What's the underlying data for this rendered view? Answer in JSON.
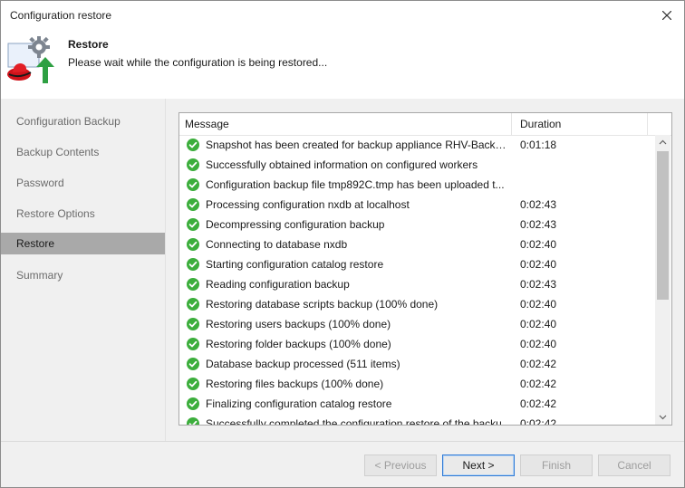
{
  "window": {
    "title": "Configuration restore"
  },
  "header": {
    "title": "Restore",
    "subtitle": "Please wait while the configuration is being restored..."
  },
  "sidebar": {
    "items": [
      {
        "label": "Configuration Backup",
        "active": false
      },
      {
        "label": "Backup Contents",
        "active": false
      },
      {
        "label": "Password",
        "active": false
      },
      {
        "label": "Restore Options",
        "active": false
      },
      {
        "label": "Restore",
        "active": true
      },
      {
        "label": "Summary",
        "active": false
      }
    ]
  },
  "log": {
    "columns": {
      "message": "Message",
      "duration": "Duration"
    },
    "rows": [
      {
        "message": "Snapshot has been created for backup appliance RHV-Backup...",
        "duration": "0:01:18"
      },
      {
        "message": "Successfully obtained information on configured workers",
        "duration": ""
      },
      {
        "message": "Configuration backup file tmp892C.tmp has been uploaded t...",
        "duration": ""
      },
      {
        "message": "Processing configuration nxdb at localhost",
        "duration": "0:02:43"
      },
      {
        "message": "Decompressing configuration backup",
        "duration": "0:02:43"
      },
      {
        "message": "Connecting to database nxdb",
        "duration": "0:02:40"
      },
      {
        "message": "Starting configuration catalog restore",
        "duration": "0:02:40"
      },
      {
        "message": "Reading configuration backup",
        "duration": "0:02:43"
      },
      {
        "message": "Restoring database scripts backup (100% done)",
        "duration": "0:02:40"
      },
      {
        "message": "Restoring users backups (100% done)",
        "duration": "0:02:40"
      },
      {
        "message": "Restoring folder backups (100% done)",
        "duration": "0:02:40"
      },
      {
        "message": "Database backup processed (511 items)",
        "duration": "0:02:42"
      },
      {
        "message": "Restoring files backups (100% done)",
        "duration": "0:02:42"
      },
      {
        "message": "Finalizing configuration catalog restore",
        "duration": "0:02:42"
      },
      {
        "message": "Successfully completed the configuration restore of the backu...",
        "duration": "0:02:42"
      }
    ],
    "status_icon": "success-check-icon",
    "status_color": "#3cae3c"
  },
  "footer": {
    "previous_label": "< Previous",
    "next_label": "Next >",
    "finish_label": "Finish",
    "cancel_label": "Cancel"
  }
}
